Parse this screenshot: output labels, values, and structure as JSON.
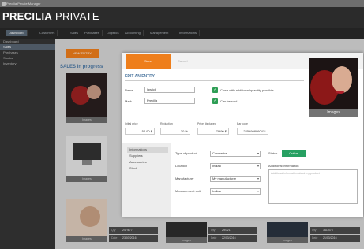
{
  "window": {
    "title": "Precilia Private Manager"
  },
  "brand": {
    "bold": "PRECILIA",
    "light": " PRIVATE"
  },
  "menu": [
    "Dashboard",
    "Customers",
    "Sales",
    "Purchases",
    "Logistics",
    "Accounting",
    "Management",
    "Informations"
  ],
  "sidebar": [
    "Dashboard",
    "Sales",
    "Purchases",
    "Stocks",
    "Inventory"
  ],
  "background": {
    "add_button": "NEW ENTRY",
    "section_title": "SALES in progress",
    "tile_label": "Images",
    "stats": [
      {
        "qty_label": "Qty",
        "qty": "247/677",
        "date_label": "Date",
        "date": "23/03/2016"
      },
      {
        "qty_label": "Qty",
        "qty": "29/321",
        "date_label": "Date",
        "date": "22/03/2016"
      },
      {
        "qty_label": "Qty",
        "qty": "341/476",
        "date_label": "Date",
        "date": "21/03/2016"
      }
    ]
  },
  "modal": {
    "save": "Save",
    "cancel": "Cancel",
    "title": "EDIT AN ENTRY",
    "name_label": "Name",
    "name_value": "lipstick",
    "mark_label": "Mark",
    "mark_value": "Precilia",
    "check1": "Close with additional quantity possible",
    "check2": "Can be sold",
    "price_heads": [
      "Initial price",
      "Reduction",
      "Price displayed",
      "Bar code"
    ],
    "price_values": [
      "54.90 $",
      "30 %",
      "79.90 $",
      "2256998960411"
    ],
    "image_label": "Images",
    "tabs": [
      "Informations",
      "Suppliers",
      "Accessories",
      "Stock"
    ],
    "type_label": "Type of product",
    "type_value": "Cosmetics",
    "location_label": "Location",
    "location_value": "Indian",
    "manufacturer_label": "Manufacturer",
    "manufacturer_value": "My manufacturer",
    "unit_label": "Measurement unit",
    "unit_value": "Indian",
    "status_label": "Status",
    "status_value": "Online",
    "info_label": "Additional information",
    "info_placeholder": "Additional information about my product"
  },
  "colors": {
    "accent": "#ee7e1b",
    "title_blue": "#49749d",
    "green": "#27a062"
  }
}
